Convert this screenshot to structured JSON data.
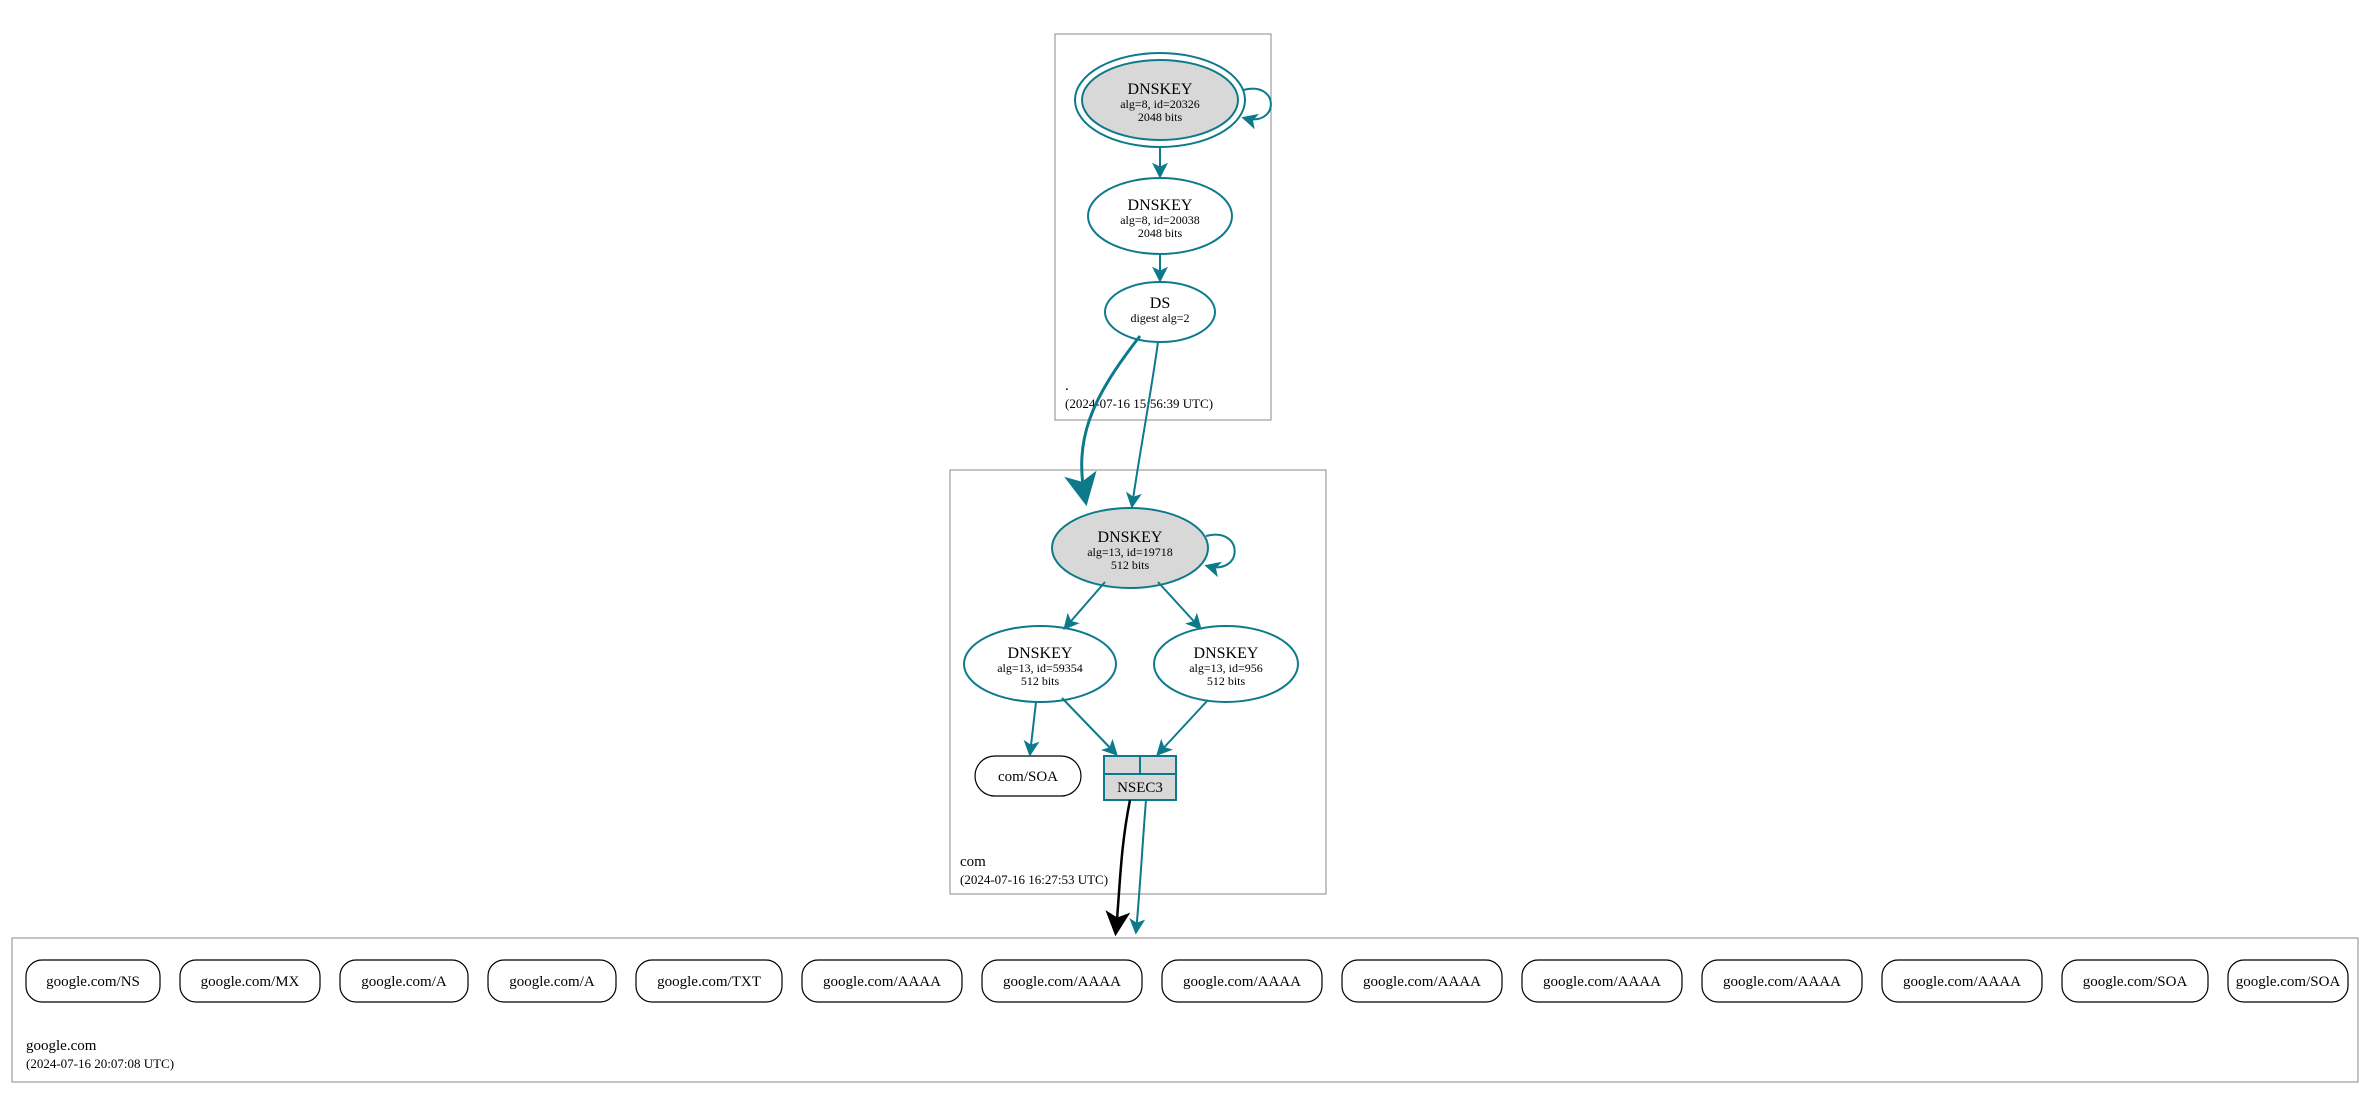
{
  "colors": {
    "teal": "#0d7a8c",
    "ksk_fill": "#d8d8d8"
  },
  "zones": {
    "root": {
      "name": ".",
      "timestamp": "(2024-07-16 15:56:39 UTC)",
      "nodes": {
        "ksk": {
          "title": "DNSKEY",
          "line2": "alg=8, id=20326",
          "line3": "2048 bits"
        },
        "zsk": {
          "title": "DNSKEY",
          "line2": "alg=8, id=20038",
          "line3": "2048 bits"
        },
        "ds": {
          "title": "DS",
          "line2": "digest alg=2"
        }
      }
    },
    "com": {
      "name": "com",
      "timestamp": "(2024-07-16 16:27:53 UTC)",
      "nodes": {
        "ksk": {
          "title": "DNSKEY",
          "line2": "alg=13, id=19718",
          "line3": "512 bits"
        },
        "zsk1": {
          "title": "DNSKEY",
          "line2": "alg=13, id=59354",
          "line3": "512 bits"
        },
        "zsk2": {
          "title": "DNSKEY",
          "line2": "alg=13, id=956",
          "line3": "512 bits"
        },
        "soa": {
          "title": "com/SOA"
        },
        "nsec3": {
          "title": "NSEC3"
        }
      }
    },
    "google": {
      "name": "google.com",
      "timestamp": "(2024-07-16 20:07:08 UTC)",
      "records": [
        "google.com/NS",
        "google.com/MX",
        "google.com/A",
        "google.com/A",
        "google.com/TXT",
        "google.com/AAAA",
        "google.com/AAAA",
        "google.com/AAAA",
        "google.com/AAAA",
        "google.com/AAAA",
        "google.com/AAAA",
        "google.com/AAAA",
        "google.com/SOA",
        "google.com/SOA"
      ]
    }
  }
}
